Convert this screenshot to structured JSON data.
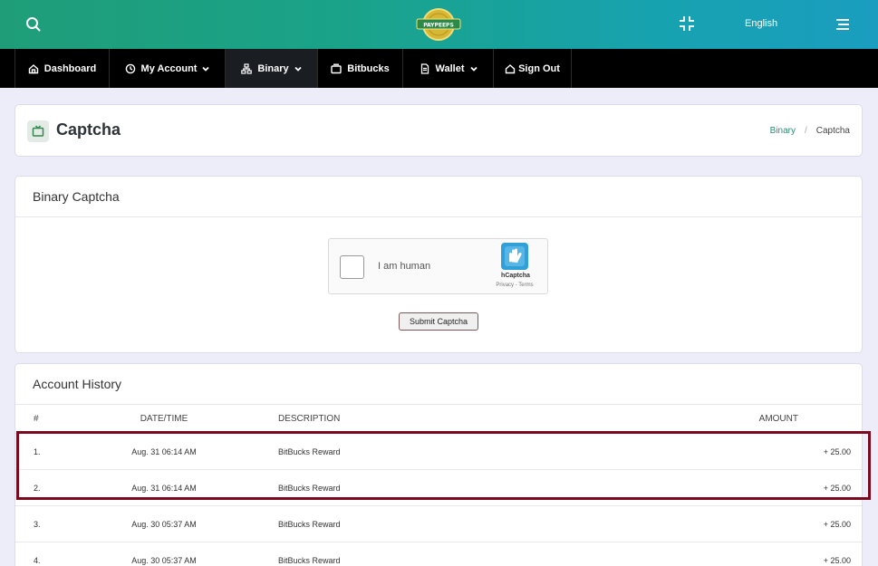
{
  "header": {
    "logo_text": "PAYPEEPS",
    "language": "English",
    "icons": [
      "search-icon",
      "minimize-icon",
      "menu-icon"
    ]
  },
  "nav": {
    "items": [
      {
        "label": "Dashboard",
        "icon": "home-icon"
      },
      {
        "label": "My Account",
        "icon": "clock-icon",
        "dropdown": true
      },
      {
        "label": "Binary",
        "icon": "sitemap-icon",
        "dropdown": true,
        "active": true
      },
      {
        "label": "Bitbucks",
        "icon": "wallet-icon"
      },
      {
        "label": "Wallet",
        "icon": "document-icon",
        "dropdown": true
      },
      {
        "label": "Sign Out",
        "icon": "house-icon"
      }
    ]
  },
  "page": {
    "title": "Captcha",
    "icon": "tv-icon",
    "breadcrumb": [
      "Binary",
      "Captcha"
    ]
  },
  "captcha_card": {
    "title": "Binary Captcha",
    "hcaptcha": {
      "label": "I am human",
      "brand": "hCaptcha",
      "links": "Privacy - Terms"
    },
    "submit_label": "Submit Captcha"
  },
  "history": {
    "title": "Account History",
    "columns": [
      "#",
      "DATE/TIME",
      "DESCRIPTION",
      "AMOUNT"
    ],
    "rows": [
      {
        "num": "1.",
        "date": "Aug. 31 06:14 AM",
        "desc": "BitBucks Reward",
        "amount": "+ 25.00"
      },
      {
        "num": "2.",
        "date": "Aug. 31 06:14 AM",
        "desc": "BitBucks Reward",
        "amount": "+ 25.00"
      },
      {
        "num": "3.",
        "date": "Aug. 30 05:37 AM",
        "desc": "BitBucks Reward",
        "amount": "+ 25.00"
      },
      {
        "num": "4.",
        "date": "Aug. 30 05:37 AM",
        "desc": "BitBucks Reward",
        "amount": "+ 25.00"
      }
    ]
  },
  "colors": {
    "header_start": "#1f9d78",
    "header_end": "#1a9dbf",
    "nav_bg": "#000000",
    "highlight": "#7c0a1e",
    "link": "#2e8b74"
  }
}
